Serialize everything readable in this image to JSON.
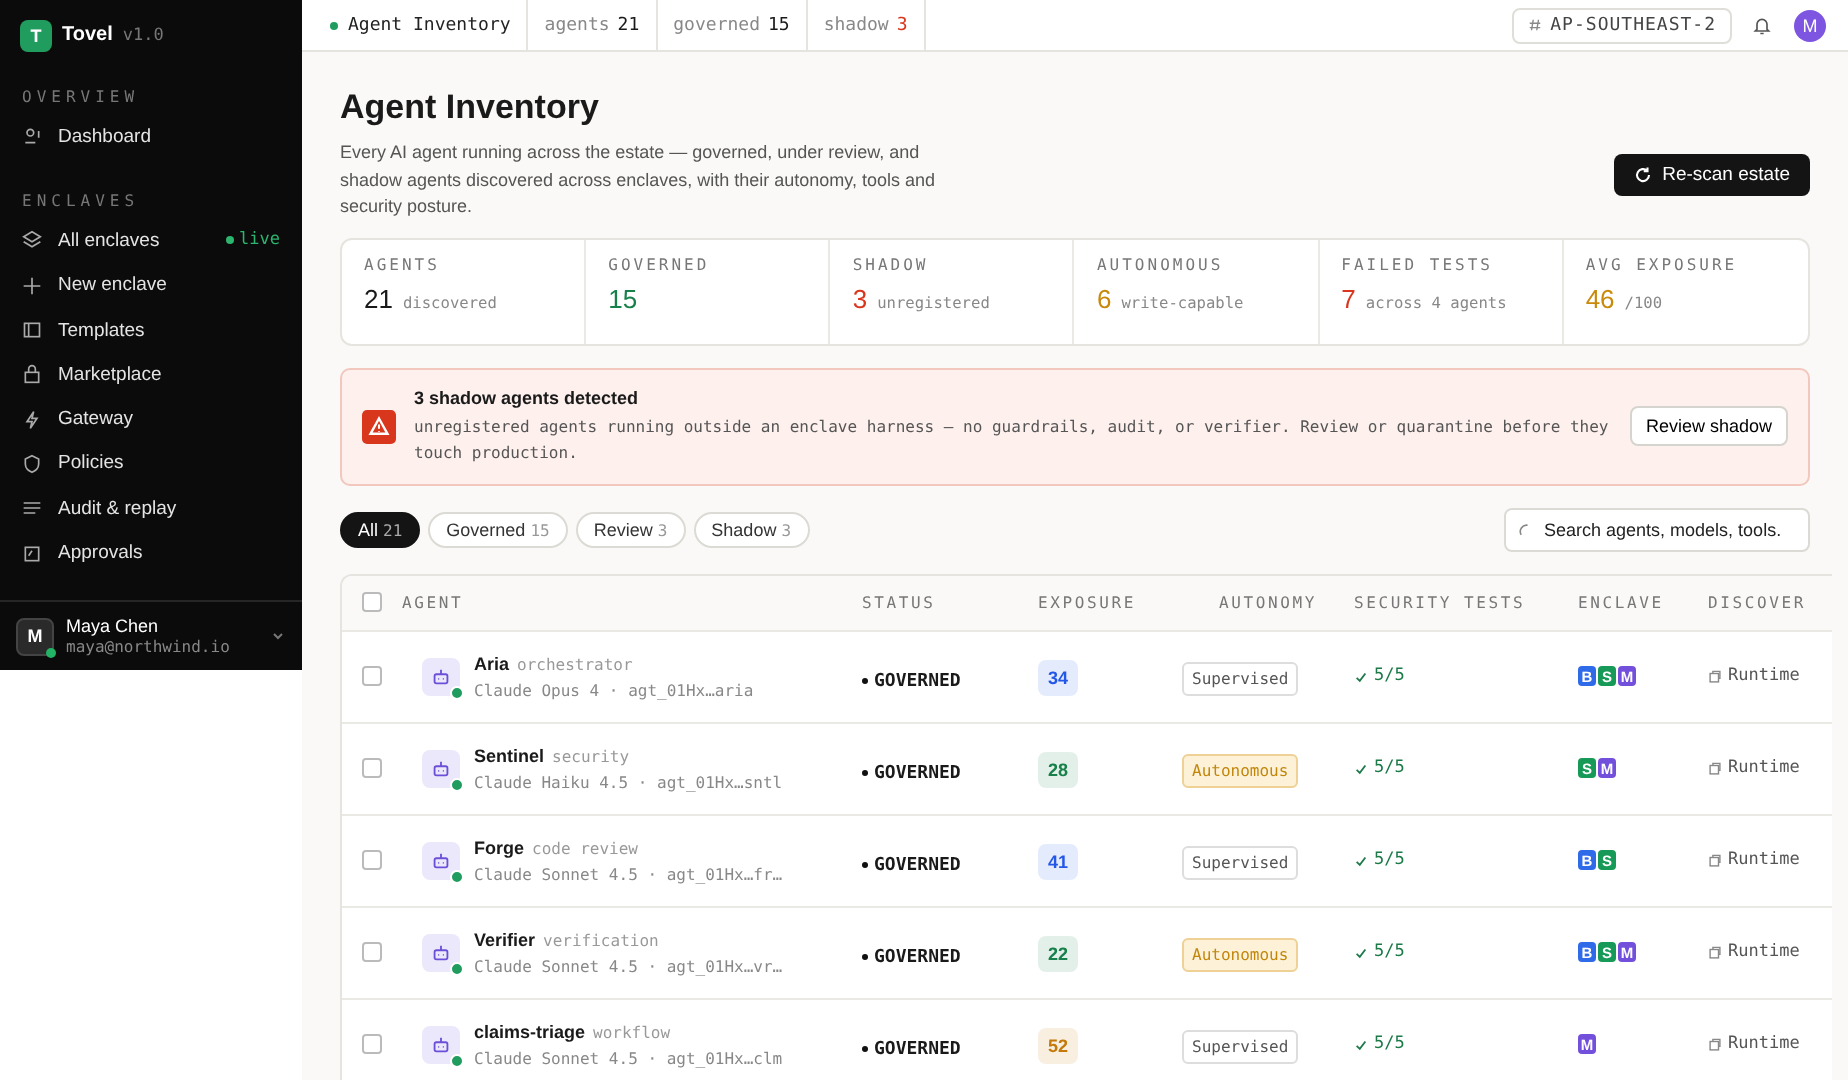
{
  "brand": {
    "logo": "T",
    "name": "Tovel",
    "version": "v1.0"
  },
  "sidebar": {
    "sections": [
      {
        "title": "OVERVIEW",
        "items": [
          {
            "label": "Dashboard",
            "selected": false
          }
        ]
      },
      {
        "title": "ENCLAVES",
        "items": [
          {
            "label": "All enclaves",
            "selected": false,
            "badge": "live"
          },
          {
            "label": "New enclave",
            "selected": false
          },
          {
            "label": "Templates",
            "selected": false
          },
          {
            "label": "Marketplace",
            "selected": false
          },
          {
            "label": "Gateway",
            "selected": false
          },
          {
            "label": "Policies",
            "selected": false
          },
          {
            "label": "Audit & replay",
            "selected": false
          },
          {
            "label": "Approvals",
            "selected": false
          }
        ]
      }
    ],
    "user": {
      "initial": "M",
      "name": "Maya Chen",
      "email": "maya@northwind.io",
      "online": true
    }
  },
  "topbar": {
    "crumb": "Agent Inventory",
    "counters": [
      {
        "label": "agents",
        "value": "21",
        "color": "#1a1a1a"
      },
      {
        "label": "governed",
        "value": "15",
        "color": "#1a1a1a"
      },
      {
        "label": "shadow",
        "value": "3",
        "color": "#d9361e"
      }
    ],
    "region": "AP-SOUTHEAST-2",
    "avatar": "M"
  },
  "header": {
    "title": "Agent Inventory",
    "description": "Every AI agent running across the estate — governed, under review, and shadow agents discovered across enclaves, with their autonomy, tools and security posture.",
    "action": "Re-scan estate"
  },
  "stats": [
    {
      "label": "AGENTS",
      "value": "21",
      "note": "discovered",
      "color": "#1a1a1a"
    },
    {
      "label": "GOVERNED",
      "value": "15",
      "color": "#17804b"
    },
    {
      "label": "SHADOW",
      "value": "3",
      "note": "unregistered",
      "color": "#d9361e"
    },
    {
      "label": "AUTONOMOUS",
      "value": "6",
      "note": "write-capable",
      "color": "#c98a0c"
    },
    {
      "label": "FAILED TESTS",
      "value": "7",
      "note": "across 4 agents",
      "color": "#d9361e"
    },
    {
      "label": "AVG EXPOSURE",
      "value": "46",
      "note": "/100",
      "color": "#c98a0c"
    }
  ],
  "alert": {
    "title": "3 shadow agents detected",
    "message": "unregistered agents running outside an enclave harness — no guardrails, audit, or verifier. Review or quarantine before they touch production.",
    "action": "Review shadow"
  },
  "filters": [
    {
      "label": "All",
      "count": "21",
      "selected": true
    },
    {
      "label": "Governed",
      "count": "15",
      "selected": false
    },
    {
      "label": "Review",
      "count": "3",
      "selected": false
    },
    {
      "label": "Shadow",
      "count": "3",
      "selected": false
    }
  ],
  "search": {
    "placeholder": "Search agents, models, tools."
  },
  "table": {
    "select_all_checked": false,
    "columns": [
      "AGENT",
      "STATUS",
      "EXPOSURE",
      "AUTONOMY",
      "SECURITY TESTS",
      "ENCLAVE",
      "DISCOVER"
    ],
    "rows": [
      {
        "name": "Aria",
        "role": "orchestrator",
        "meta": "Claude Opus 4 · agt_01Hx…aria",
        "online": true,
        "checked": false,
        "status": "GOVERNED",
        "exposure": "34",
        "color": "#2357e8",
        "autonomy": "Supervised",
        "kind": "supervised",
        "tests": "5/5",
        "enclaves": [
          {
            "letter": "B",
            "color": "#2f6ae8"
          },
          {
            "letter": "S",
            "color": "#179a57"
          },
          {
            "letter": "M",
            "color": "#7350dc"
          }
        ],
        "discovered": "Runtime"
      },
      {
        "name": "Sentinel",
        "role": "security",
        "meta": "Claude Haiku 4.5 · agt_01Hx…sntl",
        "online": true,
        "checked": false,
        "status": "GOVERNED",
        "exposure": "28",
        "color": "#17804b",
        "autonomy": "Autonomous",
        "kind": "autonomous",
        "tests": "5/5",
        "enclaves": [
          {
            "letter": "S",
            "color": "#179a57"
          },
          {
            "letter": "M",
            "color": "#7350dc"
          }
        ],
        "discovered": "Runtime"
      },
      {
        "name": "Forge",
        "role": "code review",
        "meta": "Claude Sonnet 4.5 · agt_01Hx…fr…",
        "online": true,
        "checked": false,
        "status": "GOVERNED",
        "exposure": "41",
        "color": "#2357e8",
        "autonomy": "Supervised",
        "kind": "supervised",
        "tests": "5/5",
        "enclaves": [
          {
            "letter": "B",
            "color": "#2f6ae8"
          },
          {
            "letter": "S",
            "color": "#179a57"
          }
        ],
        "discovered": "Runtime"
      },
      {
        "name": "Verifier",
        "role": "verification",
        "meta": "Claude Sonnet 4.5 · agt_01Hx…vr…",
        "online": true,
        "checked": false,
        "status": "GOVERNED",
        "exposure": "22",
        "color": "#17804b",
        "autonomy": "Autonomous",
        "kind": "autonomous",
        "tests": "5/5",
        "enclaves": [
          {
            "letter": "B",
            "color": "#2f6ae8"
          },
          {
            "letter": "S",
            "color": "#179a57"
          },
          {
            "letter": "M",
            "color": "#7350dc"
          }
        ],
        "discovered": "Runtime"
      },
      {
        "name": "claims-triage",
        "role": "workflow",
        "meta": "Claude Sonnet 4.5 · agt_01Hx…clm",
        "online": true,
        "checked": false,
        "status": "GOVERNED",
        "exposure": "52",
        "color": "#c47a0a",
        "autonomy": "Supervised",
        "kind": "supervised",
        "tests": "5/5",
        "enclaves": [
          {
            "letter": "M",
            "color": "#7350dc"
          }
        ],
        "discovered": "Runtime"
      }
    ]
  }
}
